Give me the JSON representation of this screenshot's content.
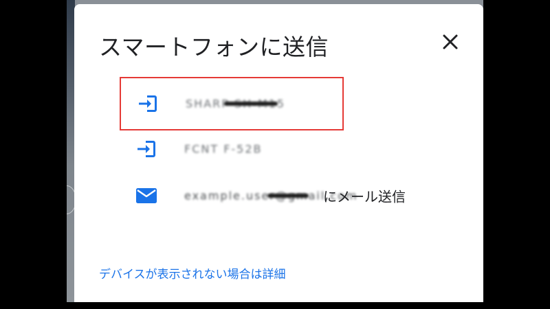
{
  "dialog": {
    "title": "スマートフォンに送信",
    "close_icon": "close-icon"
  },
  "devices": [
    {
      "name": "SHARP SH-M15",
      "icon": "send-to-device-icon",
      "selected": true
    },
    {
      "name": "FCNT F-52B",
      "icon": "send-to-device-icon",
      "selected": false
    }
  ],
  "email_option": {
    "address": "example.user@gmail.com",
    "suffix": "にメール送信",
    "icon": "mail-icon"
  },
  "help_link": "デバイスが表示されない場合は詳細",
  "colors": {
    "accent": "#1a73e8",
    "selection_border": "#e53935",
    "title_text": "#202124"
  }
}
